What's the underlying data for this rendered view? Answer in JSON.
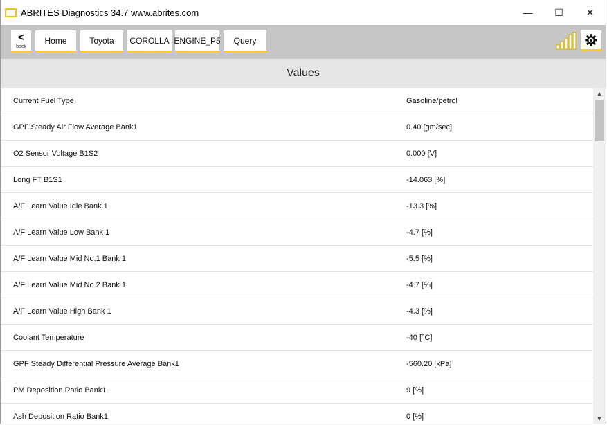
{
  "window": {
    "title": "ABRITES Diagnostics 34.7   www.abrites.com",
    "controls": {
      "minimize": "—",
      "maximize": "☐",
      "close": "✕"
    }
  },
  "toolbar": {
    "back_label": "back",
    "back_arrow": "<",
    "breadcrumbs": [
      "Home",
      "Toyota",
      "COROLLA",
      "ENGINE_P5",
      "Query"
    ],
    "accent_color": "#f5d020",
    "signal_icon": "signal-bars-icon",
    "settings_icon": "gear-icon"
  },
  "section": {
    "title": "Values"
  },
  "values": [
    {
      "name": "Current Fuel Type",
      "value": "Gasoline/petrol"
    },
    {
      "name": "GPF Steady Air Flow Average Bank1",
      "value": "0.40 [gm/sec]"
    },
    {
      "name": "O2 Sensor Voltage B1S2",
      "value": "0.000 [V]"
    },
    {
      "name": "Long FT B1S1",
      "value": "-14.063 [%]"
    },
    {
      "name": "A/F Learn Value Idle Bank 1",
      "value": "-13.3 [%]"
    },
    {
      "name": "A/F Learn Value Low Bank 1",
      "value": "-4.7 [%]"
    },
    {
      "name": "A/F Learn Value Mid No.1 Bank 1",
      "value": "-5.5 [%]"
    },
    {
      "name": "A/F Learn Value Mid No.2 Bank 1",
      "value": "-4.7 [%]"
    },
    {
      "name": "A/F Learn Value High Bank 1",
      "value": "-4.3 [%]"
    },
    {
      "name": "Coolant Temperature",
      "value": "-40 [°C]"
    },
    {
      "name": "GPF Steady Differential Pressure Average Bank1",
      "value": "-560.20 [kPa]"
    },
    {
      "name": "PM Deposition Ratio Bank1",
      "value": "9 [%]"
    },
    {
      "name": "Ash Deposition Ratio Bank1",
      "value": "0 [%]"
    }
  ]
}
